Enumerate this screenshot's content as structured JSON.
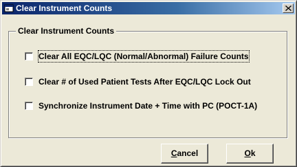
{
  "window": {
    "title": "Clear Instrument Counts",
    "close_glyph": "✕",
    "icon": "app-window-icon"
  },
  "group": {
    "label": "Clear Instrument Counts"
  },
  "options": [
    {
      "label": "Clear All EQC/LQC (Normal/Abnormal) Failure Counts",
      "checked": false,
      "focused": true
    },
    {
      "label": "Clear # of Used Patient Tests After EQC/LQC Lock Out",
      "checked": false,
      "focused": false
    },
    {
      "label": "Synchronize Instrument Date + Time with PC (POCT-1A)",
      "checked": false,
      "focused": false
    }
  ],
  "buttons": {
    "cancel": {
      "accel": "C",
      "rest": "ancel"
    },
    "ok": {
      "accel": "O",
      "rest": "k"
    }
  },
  "colors": {
    "titlebar_start": "#0a246a",
    "titlebar_end": "#a6caf0",
    "dialog_face": "#ece9d8"
  }
}
